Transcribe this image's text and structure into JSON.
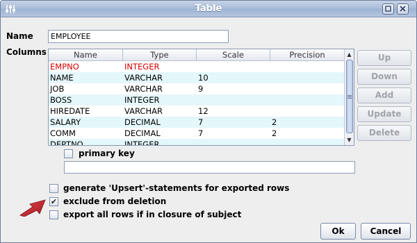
{
  "window": {
    "title": "Table"
  },
  "name_field": {
    "label": "Name",
    "value": "EMPLOYEE"
  },
  "columns": {
    "label": "Columns",
    "headers": [
      "Name",
      "Type",
      "Scale",
      "Precision"
    ],
    "rows": [
      {
        "name": "EMPNO",
        "type": "INTEGER",
        "scale": "",
        "precision": "",
        "pk": true
      },
      {
        "name": "NAME",
        "type": "VARCHAR",
        "scale": "10",
        "precision": "",
        "pk": false
      },
      {
        "name": "JOB",
        "type": "VARCHAR",
        "scale": "9",
        "precision": "",
        "pk": false
      },
      {
        "name": "BOSS",
        "type": "INTEGER",
        "scale": "",
        "precision": "",
        "pk": false
      },
      {
        "name": "HIREDATE",
        "type": "VARCHAR",
        "scale": "12",
        "precision": "",
        "pk": false
      },
      {
        "name": "SALARY",
        "type": "DECIMAL",
        "scale": "7",
        "precision": "2",
        "pk": false
      },
      {
        "name": "COMM",
        "type": "DECIMAL",
        "scale": "7",
        "precision": "2",
        "pk": false
      },
      {
        "name": "DEPTNO",
        "type": "INTEGER",
        "scale": "",
        "precision": "",
        "pk": false
      }
    ]
  },
  "side_buttons": {
    "up": "Up",
    "down": "Down",
    "add": "Add",
    "update": "Update",
    "delete": "Delete"
  },
  "primary_key": {
    "label": "primary key",
    "checked": false
  },
  "column_edit": {
    "value": ""
  },
  "options": {
    "upsert": {
      "label": "generate 'Upsert'-statements for exported rows",
      "checked": false
    },
    "exclude": {
      "label": "exclude from deletion",
      "checked": true
    },
    "export_all": {
      "label": "export all rows if in closure of subject",
      "checked": false
    }
  },
  "buttons": {
    "ok": "Ok",
    "cancel": "Cancel"
  },
  "colors": {
    "pk_text": "#d40000",
    "alt_row": "#e4f7fb",
    "arrow": "#c4202a"
  },
  "icons": {
    "window_menu": "window-menu-icon",
    "minimize": "minimize-icon",
    "close": "close-icon",
    "pointer": "red-arrow-icon"
  }
}
